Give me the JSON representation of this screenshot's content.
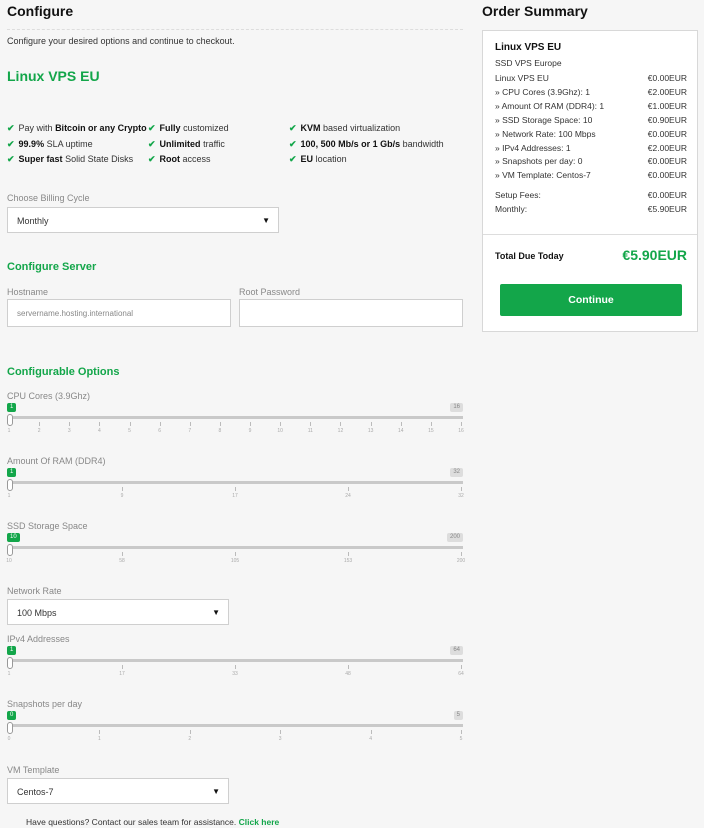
{
  "configure": {
    "title": "Configure",
    "intro": "Configure your desired options and continue to checkout.",
    "product_name": "Linux VPS EU",
    "features": [
      {
        "bold": "",
        "pre": "Pay with ",
        "b": "Bitcoin or any Crypto",
        "post": ""
      },
      {
        "pre": "",
        "b": "Fully",
        "post": " customized"
      },
      {
        "pre": "",
        "b": "KVM",
        "post": " based virtualization"
      },
      {
        "pre": "",
        "b": "99.9%",
        "post": " SLA uptime"
      },
      {
        "pre": "",
        "b": "Unlimited",
        "post": " traffic"
      },
      {
        "pre": "",
        "b": "100, 500 Mb/s or 1 Gb/s",
        "post": " bandwidth"
      },
      {
        "pre": "",
        "b": "Super fast",
        "post": " Solid State Disks"
      },
      {
        "pre": "",
        "b": "Root",
        "post": " access"
      },
      {
        "pre": "",
        "b": "EU",
        "post": " location"
      }
    ],
    "billing_label": "Choose Billing Cycle",
    "billing_value": "Monthly",
    "server_title": "Configure Server",
    "hostname_label": "Hostname",
    "hostname_placeholder": "servername.hosting.international",
    "password_label": "Root Password",
    "options_title": "Configurable Options",
    "sliders": [
      {
        "label": "CPU Cores (3.9Ghz)",
        "min": "1",
        "max": "16",
        "value": 1,
        "ticks": [
          "1",
          "2",
          "3",
          "4",
          "5",
          "6",
          "7",
          "8",
          "9",
          "10",
          "11",
          "12",
          "13",
          "14",
          "15",
          "16"
        ]
      },
      {
        "label": "Amount Of RAM (DDR4)",
        "min": "1",
        "max": "32",
        "value": 1,
        "ticks": [
          "1",
          "9",
          "17",
          "24",
          "32"
        ]
      },
      {
        "label": "SSD Storage Space",
        "min": "10",
        "max": "200",
        "value": 10,
        "ticks": [
          "10",
          "58",
          "105",
          "153",
          "200"
        ]
      }
    ],
    "network_label": "Network Rate",
    "network_value": "100 Mbps",
    "sliders2": [
      {
        "label": "IPv4 Addresses",
        "min": "1",
        "max": "64",
        "value": 1,
        "ticks": [
          "1",
          "17",
          "33",
          "48",
          "64"
        ]
      },
      {
        "label": "Snapshots per day",
        "min": "0",
        "max": "5",
        "value": 0,
        "ticks": [
          "0",
          "1",
          "2",
          "3",
          "4",
          "5"
        ]
      }
    ],
    "template_label": "VM Template",
    "template_value": "Centos-7",
    "help_text": "Have questions? Contact our sales team for assistance.",
    "help_link": "Click here"
  },
  "summary": {
    "title": "Order Summary",
    "product": "Linux VPS EU",
    "group": "SSD VPS Europe",
    "lines": [
      {
        "label": "Linux VPS EU",
        "value": "€0.00EUR"
      },
      {
        "label": " » CPU Cores (3.9Ghz): 1",
        "value": "€2.00EUR"
      },
      {
        "label": " » Amount Of RAM (DDR4): 1",
        "value": "€1.00EUR"
      },
      {
        "label": " » SSD Storage Space: 10",
        "value": "€0.90EUR"
      },
      {
        "label": " » Network Rate: 100 Mbps",
        "value": "€0.00EUR"
      },
      {
        "label": " » IPv4 Addresses: 1",
        "value": "€2.00EUR"
      },
      {
        "label": " » Snapshots per day: 0",
        "value": "€0.00EUR"
      },
      {
        "label": " » VM Template: Centos-7",
        "value": "€0.00EUR"
      }
    ],
    "setup_label": "Setup Fees:",
    "setup_value": "€0.00EUR",
    "monthly_label": "Monthly:",
    "monthly_value": "€5.90EUR",
    "total_label": "Total Due Today",
    "total_value": "€5.90EUR",
    "continue_label": "Continue"
  },
  "colors": {
    "accent": "#13a64a"
  },
  "icons": {
    "check": "check-icon",
    "caret": "caret-down-icon"
  }
}
